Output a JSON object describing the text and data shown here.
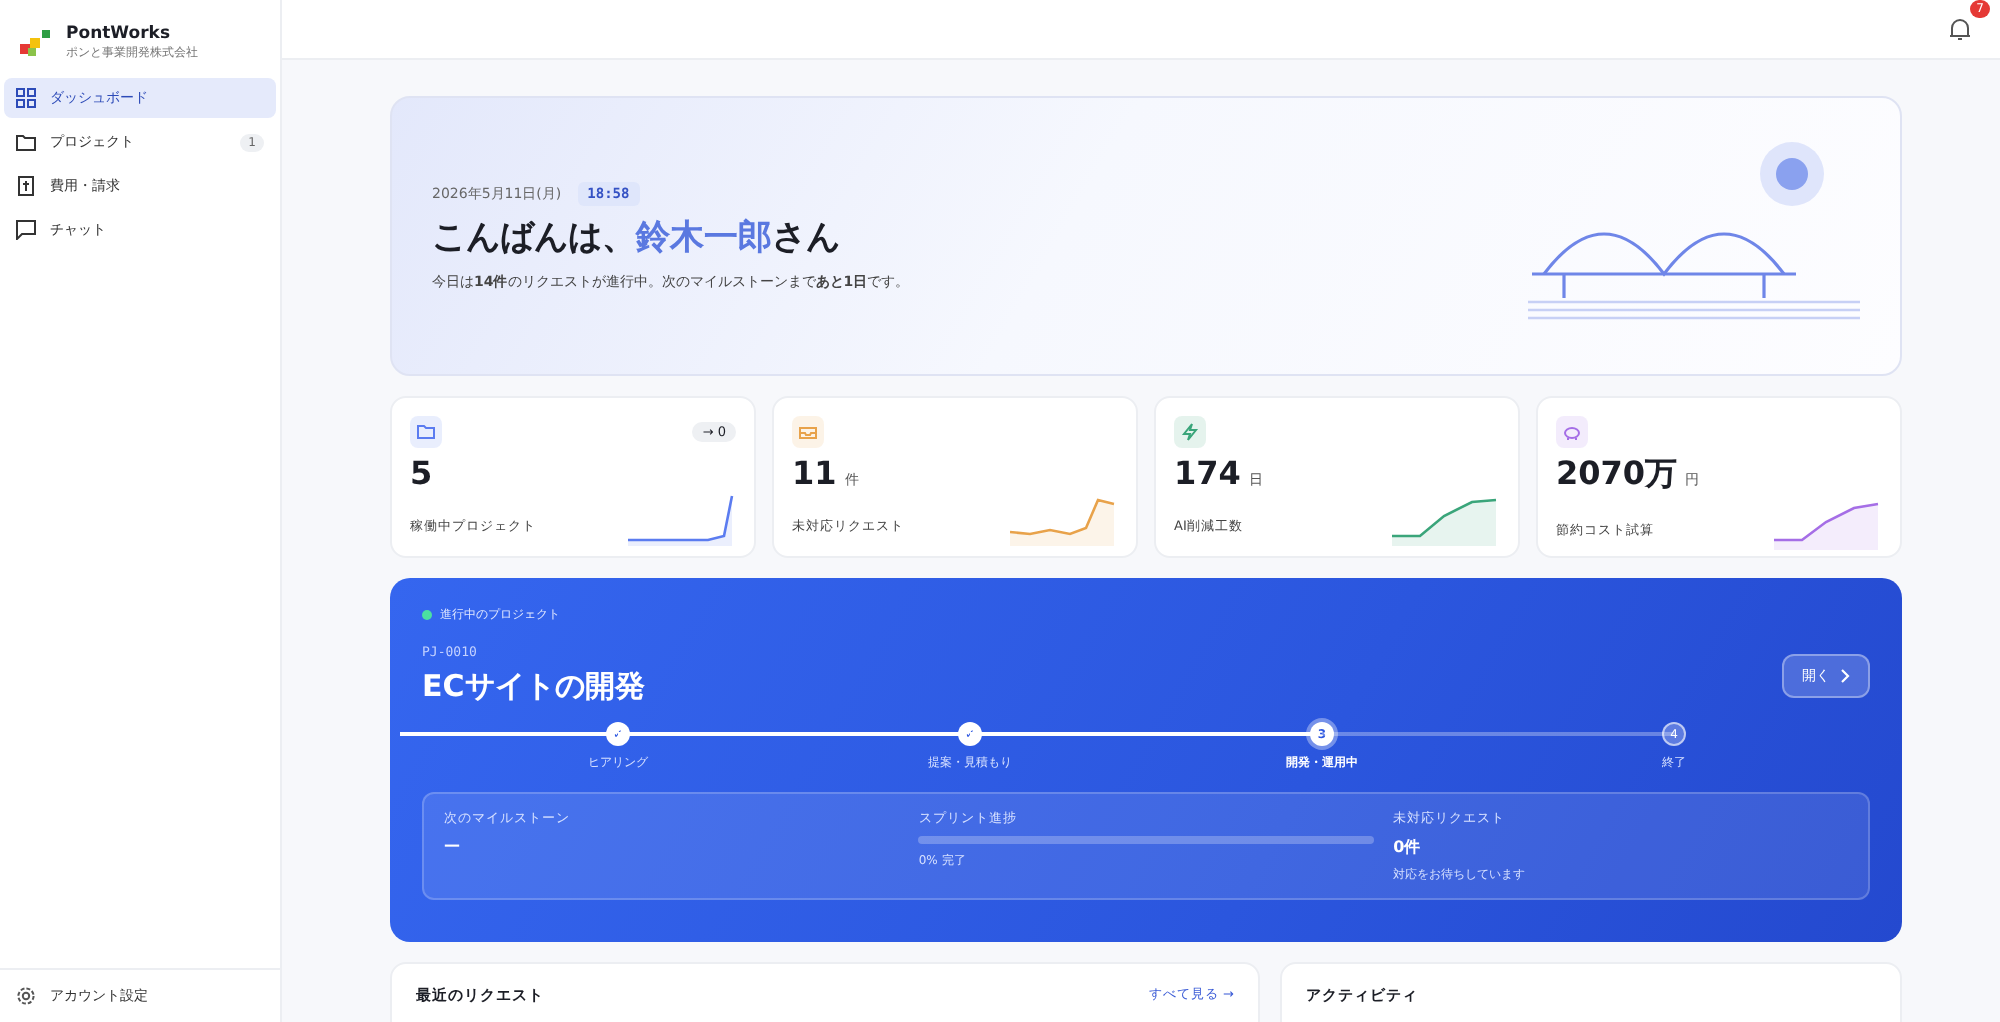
{
  "brand": {
    "name": "PontWorks",
    "company": "ポンと事業開発株式会社"
  },
  "nav": [
    {
      "label": "ダッシュボード",
      "selected": true,
      "kind": "grid"
    },
    {
      "label": "プロジェクト",
      "selected": false,
      "kind": "folder",
      "count": "1"
    },
    {
      "label": "費用・請求",
      "selected": false,
      "kind": "bill"
    },
    {
      "label": "チャット",
      "selected": false,
      "kind": "chat"
    }
  ],
  "account": {
    "label": "アカウント設定"
  },
  "notifications": {
    "count": "7"
  },
  "hero": {
    "date": "2026年5月11日(月)",
    "time": "18:58",
    "greeting": "こんばんは、",
    "name": "鈴木一郎",
    "suffix": "さん",
    "message": "今日は**14件**のリクエストが進行中。次のマイルストーンまで**あと1日**です。"
  },
  "stats": [
    {
      "kind": "folder",
      "value": "5",
      "label": "稼働中プロジェクト",
      "delta": "→ 0",
      "color": "#5b7cf0"
    },
    {
      "kind": "inbox",
      "value": "11",
      "unit": "件",
      "label": "未対応リクエスト",
      "color": "#e8a24a"
    },
    {
      "kind": "bolt",
      "value": "174",
      "unit": "日",
      "label": "AI削減工数",
      "color": "#3aa57a"
    },
    {
      "kind": "piggy",
      "value": "2070万",
      "unit": "円",
      "label": "節約コスト試算",
      "color": "#a56ee6"
    }
  ],
  "project": {
    "status": "進行中のプロジェクト",
    "code": "PJ-0010",
    "title": "ECサイトの開発",
    "open_button": "開く",
    "steps": [
      {
        "label": "ヒアリング",
        "completed": true,
        "selected": false,
        "marker": "✓"
      },
      {
        "label": "提案・見積もり",
        "completed": true,
        "selected": false,
        "marker": "✓"
      },
      {
        "label": "開発・運用中",
        "completed": false,
        "selected": true,
        "marker": "3"
      },
      {
        "label": "終了",
        "completed": false,
        "selected": false,
        "marker": "4"
      }
    ],
    "milestone": {
      "label": "次のマイルストーン",
      "value": "—"
    },
    "sprint": {
      "label": "スプリント進捗",
      "level": 0,
      "reading": "0% 完了"
    },
    "requests": {
      "label": "未対応リクエスト",
      "value": "0件",
      "note": "対応をお待ちしています"
    }
  },
  "recent": {
    "title": "最近のリクエスト",
    "link": "すべて見る →"
  },
  "activity": {
    "title": "アクティビティ"
  }
}
